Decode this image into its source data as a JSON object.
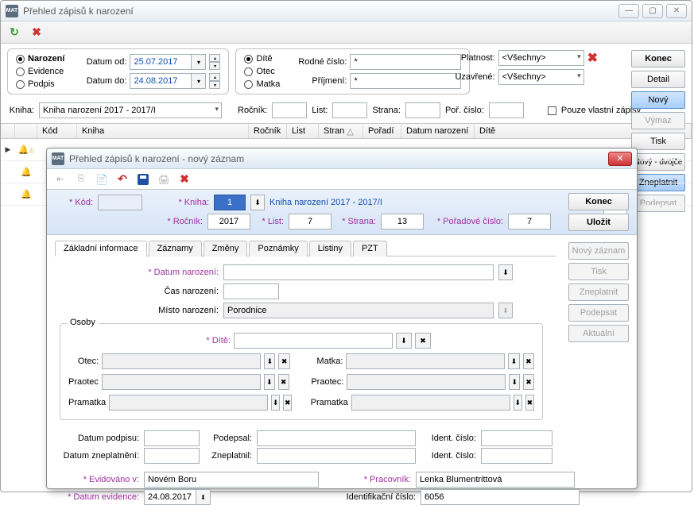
{
  "main": {
    "title": "Přehled zápisů k narození",
    "app_icon_text": "MAT",
    "radios1": {
      "narozeni": "Narození",
      "evidence": "Evidence",
      "podpis": "Podpis"
    },
    "datum_od_label": "Datum od:",
    "datum_od": "25.07.2017",
    "datum_do_label": "Datum do:",
    "datum_do": "24.08.2017",
    "radios2": {
      "dite": "Dítě",
      "otec": "Otec",
      "matka": "Matka"
    },
    "rodne_cislo_label": "Rodné číslo:",
    "rodne_cislo": "*",
    "prijmeni_label": "Příjmení:",
    "prijmeni": "*",
    "platnost_label": "Platnost:",
    "platnost_value": "<Všechny>",
    "uzavrene_label": "Uzavřené:",
    "uzavrene_value": "<Všechny>",
    "kniha_label": "Kniha:",
    "kniha_value": "Kniha narození 2017 - 2017/I",
    "rocnik_label": "Ročník:",
    "list_label": "List:",
    "strana_label": "Strana:",
    "por_label": "Poř. číslo:",
    "pouze_vlastni": "Pouze vlastní zápisy",
    "cols": {
      "kod": "Kód",
      "kniha": "Kniha",
      "rocnik": "Ročník",
      "list": "List",
      "stran": "Stran",
      "stran_sort": "△",
      "poradi": "Pořadí",
      "datum": "Datum narození",
      "dite": "Dítě"
    },
    "buttons": {
      "konec": "Konec",
      "detail": "Detail",
      "novy": "Nový",
      "vymaz": "Výmaz",
      "tisk": "Tisk",
      "novy_dvojce": "Nový - dvojče",
      "zneplatnit": "Zneplatnit",
      "podepsat": "Podepsat"
    }
  },
  "modal": {
    "title": "Přehled zápisů k narození - nový záznam",
    "hdr": {
      "kod_label": "* Kód:",
      "kniha_label": "* Kniha:",
      "kniha_idx": "1",
      "kniha_name": "Kniha narození 2017 - 2017/I",
      "rocnik_label": "* Ročník:",
      "rocnik": "2017",
      "list_label": "* List:",
      "list": "7",
      "strana_label": "* Strana:",
      "strana": "13",
      "por_label": "* Pořadové číslo:",
      "por": "7"
    },
    "rbuttons": {
      "konec": "Konec",
      "ulozit": "Uložit",
      "novy_zaznam": "Nový záznam",
      "tisk": "Tisk",
      "zneplatnit": "Zneplatnit",
      "podepsat": "Podepsat",
      "aktualni": "Aktuální"
    },
    "tabs": {
      "zi": "Základní informace",
      "zaz": "Záznamy",
      "zmeny": "Změny",
      "pozn": "Poznámky",
      "listiny": "Listiny",
      "pzt": "PZT"
    },
    "form": {
      "datum_narozeni_label": "* Datum narození:",
      "cas_label": "Čas narození:",
      "misto_label": "Místo narození:",
      "misto_value": "Porodnice"
    },
    "osoby": {
      "legend": "Osoby",
      "dite": "* Dítě:",
      "otec": "Otec:",
      "matka": "Matka:",
      "praotec": "Praotec",
      "praotec2": "Praotec:",
      "pramatka": "Pramatka",
      "pramatka2": "Pramatka"
    },
    "bottom": {
      "datum_podpisu": "Datum podpisu:",
      "podepsal": "Podepsal:",
      "ident1": "Ident. číslo:",
      "datum_znepl": "Datum zneplatnění:",
      "zneplatnil": "Zneplatnil:",
      "ident2": "Ident. číslo:",
      "evid_v": "* Evidováno v:",
      "evid_v_val": "Novém Boru",
      "pracovnik": "* Pracovník:",
      "pracovnik_val": "Lenka Blumentrittová",
      "datum_ev": "* Datum evidence:",
      "datum_ev_val": "24.08.2017",
      "ident_cislo": "Identifikační číslo:",
      "ident_cislo_val": "6056"
    }
  }
}
